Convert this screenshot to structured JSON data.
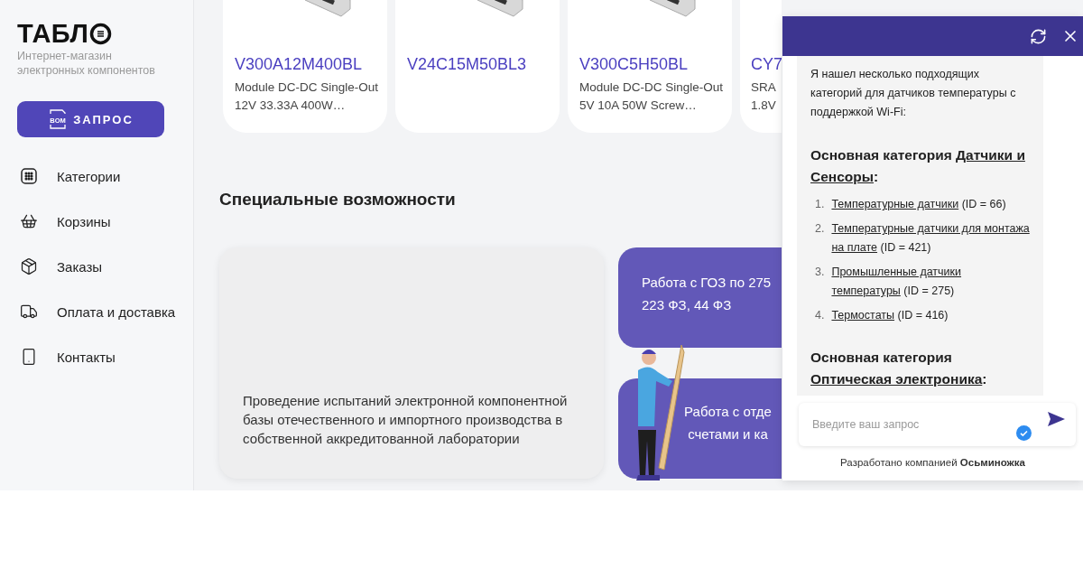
{
  "sidebar": {
    "logo": "ТАБЛ",
    "tagline": "Интернет-магазин электронных компонентов",
    "request_button": {
      "icon_label": "BOM",
      "label": "ЗАПРОС"
    },
    "items": [
      {
        "kind": "grid",
        "label": "Категории"
      },
      {
        "kind": "basket",
        "label": "Корзины"
      },
      {
        "kind": "box",
        "label": "Заказы"
      },
      {
        "kind": "truck",
        "label": "Оплата и доставка"
      },
      {
        "kind": "phone",
        "label": "Контакты"
      }
    ]
  },
  "products": [
    {
      "title": "V300A12M400BL",
      "description": "Module DC-DC Single-Out 12V 33.33A 400W…"
    },
    {
      "title": "V24C15M50BL3"
    },
    {
      "title": "V300C5H50BL",
      "description": "Module DC-DC Single-Out 5V 10A 50W Screw…"
    },
    {
      "title": "CY7",
      "description": "SRA 1.8V"
    }
  ],
  "features_heading": "Специальные возможности",
  "lab_card": {
    "text": "Проведение испытаний электронной компонентной базы отечественного и импортного производства в собственной аккредитованной лаборатории"
  },
  "feature_cards": [
    {
      "lines": [
        "Работа с ГОЗ по 275",
        "223 ФЗ, 44 ФЗ"
      ]
    },
    {
      "lines": [
        "Работа с отде",
        "счетами и ка"
      ]
    }
  ],
  "chat": {
    "intro": "Я нашел несколько подходящих категорий для датчиков температуры с поддержкой Wi-Fi:",
    "sections": [
      {
        "prefix": "Основная категория",
        "link": "Датчики и Сенсоры",
        "suffix": ":",
        "items": [
          {
            "number": "1.",
            "link": "Температурные датчики",
            "note": "(ID = 66)"
          },
          {
            "number": "2.",
            "link": "Температурные датчики для монтажа на плате",
            "note": "(ID = 421)"
          },
          {
            "number": "3.",
            "link": "Промышленные датчики температуры",
            "note": "(ID = 275)"
          },
          {
            "number": "4.",
            "link": "Термостаты",
            "note": "(ID = 416)"
          }
        ]
      },
      {
        "prefix": "Основная категория",
        "link": "Оптическая электроника",
        "suffix": ":"
      }
    ],
    "input": {
      "placeholder": "Введите ваш запрос"
    },
    "footer_prefix": "Разработано компанией",
    "footer_brand": "Осьминожка"
  }
}
